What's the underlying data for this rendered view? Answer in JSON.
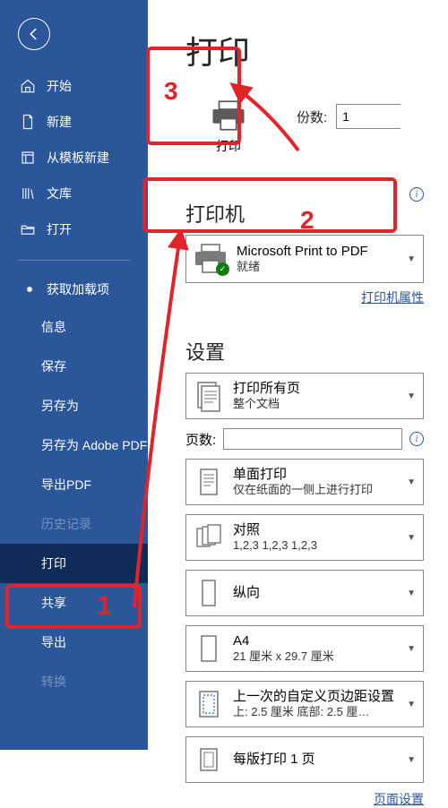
{
  "sidebar": {
    "items": [
      {
        "label": "开始"
      },
      {
        "label": "新建"
      },
      {
        "label": "从模板新建"
      },
      {
        "label": "文库"
      },
      {
        "label": "打开"
      }
    ],
    "addon_label": "获取加载项",
    "sub": {
      "info": "信息",
      "save": "保存",
      "saveas": "另存为",
      "saveas_adobe": "另存为 Adobe PDF",
      "export_pdf": "导出PDF",
      "history": "历史记录",
      "print": "打印",
      "share": "共享",
      "export": "导出",
      "transform": "转换"
    }
  },
  "main": {
    "title": "打印",
    "print_button": "打印",
    "copies_label": "份数:",
    "copies_value": "1",
    "printer_section": "打印机",
    "printer_name": "Microsoft Print to PDF",
    "printer_status": "就绪",
    "printer_props_link": "打印机属性",
    "settings_section": "设置",
    "set_all_pages_title": "打印所有页",
    "set_all_pages_sub": "整个文档",
    "pages_label": "页数:",
    "pages_value": "",
    "set_oneside_title": "单面打印",
    "set_oneside_sub": "仅在纸面的一侧上进行打印",
    "set_collate_title": "对照",
    "set_collate_sub": "1,2,3    1,2,3    1,2,3",
    "set_orient": "纵向",
    "set_paper_title": "A4",
    "set_paper_sub": "21 厘米 x 29.7 厘米",
    "set_margin_title": "上一次的自定义页边距设置",
    "set_margin_sub": "上: 2.5 厘米 底部: 2.5 厘…",
    "set_pps": "每版打印 1 页",
    "page_setup_link": "页面设置"
  },
  "annot": {
    "n1": "1",
    "n2": "2",
    "n3": "3"
  }
}
